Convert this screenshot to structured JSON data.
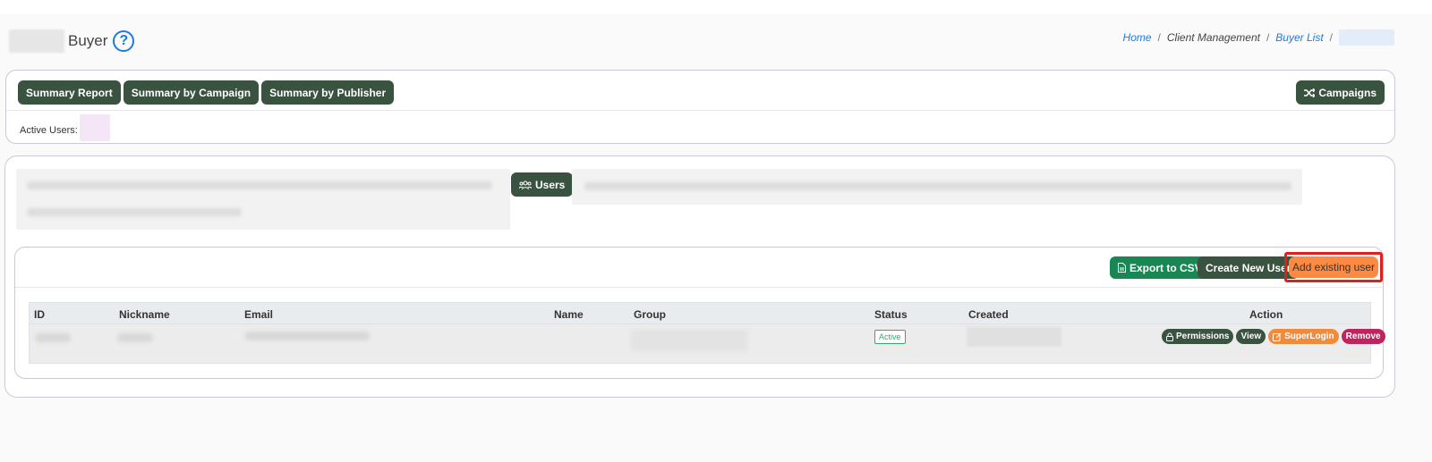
{
  "page": {
    "title": "Buyer",
    "help_icon": "?"
  },
  "breadcrumb": {
    "home": "Home",
    "client_management": "Client Management",
    "buyer_list": "Buyer List",
    "separator": "/"
  },
  "toolbar": {
    "summary_report": "Summary Report",
    "summary_by_campaign": "Summary by Campaign",
    "summary_by_publisher": "Summary by Publisher",
    "campaigns": "Campaigns"
  },
  "active_users": {
    "label": "Active Users:"
  },
  "tabs": {
    "users": "Users"
  },
  "users_panel": {
    "export_csv": "Export to CSV",
    "create_new_user": "Create New User",
    "add_existing_user": "Add existing user"
  },
  "table": {
    "columns": [
      "ID",
      "Nickname",
      "Email",
      "Name",
      "Group",
      "Status",
      "Created",
      "Action"
    ],
    "rows": [
      {
        "status": "Active",
        "actions": {
          "permissions": "Permissions",
          "view": "View",
          "superlogin": "SuperLogin",
          "remove": "Remove"
        }
      }
    ]
  },
  "colors": {
    "primary_dark": "#3a5240",
    "export_green": "#198754",
    "add_existing_orange": "#fd8a42",
    "highlight_red": "#e01f1f",
    "link_blue": "#1f7ae0",
    "remove_pink": "#c0245f"
  }
}
